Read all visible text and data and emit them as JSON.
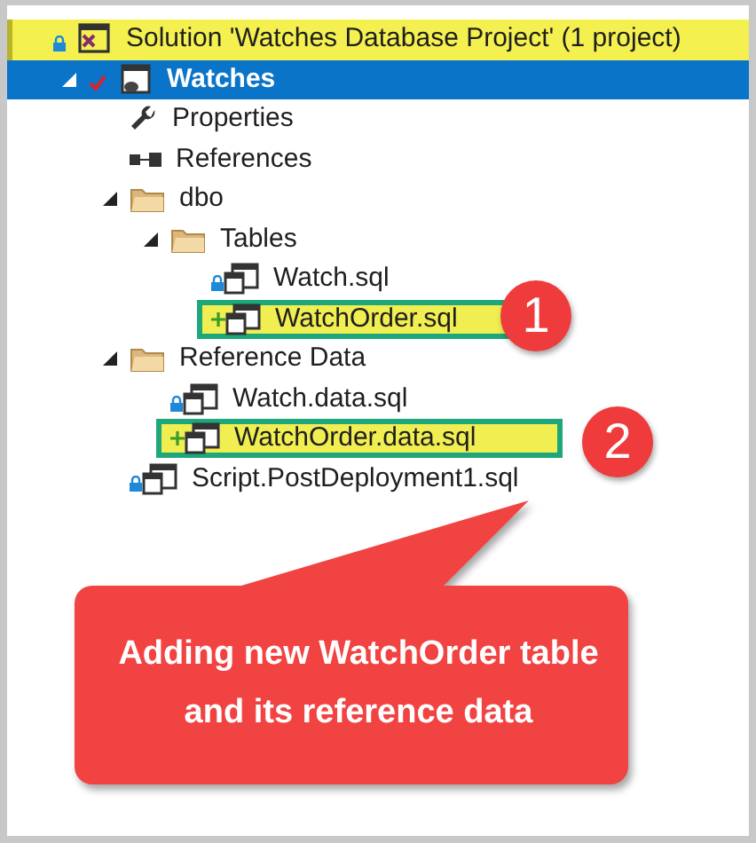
{
  "tree": [
    {
      "label": "Solution 'Watches Database Project' (1 project)",
      "kind": "solution",
      "locked": true,
      "added": false,
      "checked": false,
      "highlighted": true,
      "selected": false,
      "children": [
        {
          "label": "Watches",
          "kind": "project",
          "locked": false,
          "added": false,
          "checked": true,
          "highlighted": false,
          "selected": true,
          "expanded": true,
          "children": [
            {
              "label": "Properties",
              "kind": "properties",
              "locked": false,
              "added": false,
              "checked": false,
              "highlighted": false,
              "selected": false
            },
            {
              "label": "References",
              "kind": "references",
              "locked": false,
              "added": false,
              "checked": false,
              "highlighted": false,
              "selected": false
            },
            {
              "label": "dbo",
              "kind": "folder",
              "locked": false,
              "added": false,
              "checked": false,
              "highlighted": false,
              "selected": false,
              "expanded": true,
              "children": [
                {
                  "label": "Tables",
                  "kind": "folder",
                  "locked": false,
                  "added": false,
                  "checked": false,
                  "highlighted": false,
                  "selected": false,
                  "expanded": true,
                  "children": [
                    {
                      "label": "Watch.sql",
                      "kind": "file",
                      "locked": true,
                      "added": false,
                      "checked": false,
                      "highlighted": false,
                      "selected": false
                    },
                    {
                      "label": "WatchOrder.sql",
                      "kind": "file",
                      "locked": false,
                      "added": true,
                      "checked": false,
                      "highlighted": true,
                      "selected": false
                    }
                  ]
                }
              ]
            },
            {
              "label": "Reference Data",
              "kind": "folder",
              "locked": false,
              "added": false,
              "checked": false,
              "highlighted": false,
              "selected": false,
              "expanded": true,
              "children": [
                {
                  "label": "Watch.data.sql",
                  "kind": "file",
                  "locked": true,
                  "added": false,
                  "checked": false,
                  "highlighted": false,
                  "selected": false
                },
                {
                  "label": "WatchOrder.data.sql",
                  "kind": "file",
                  "locked": false,
                  "added": true,
                  "checked": false,
                  "highlighted": true,
                  "selected": false
                }
              ]
            },
            {
              "label": "Script.PostDeployment1.sql",
              "kind": "file",
              "locked": true,
              "added": false,
              "checked": false,
              "highlighted": false,
              "selected": false
            }
          ]
        }
      ]
    }
  ],
  "markers": [
    "1",
    "2"
  ],
  "callout": {
    "text": "Adding new WatchOrder table and its reference data"
  }
}
